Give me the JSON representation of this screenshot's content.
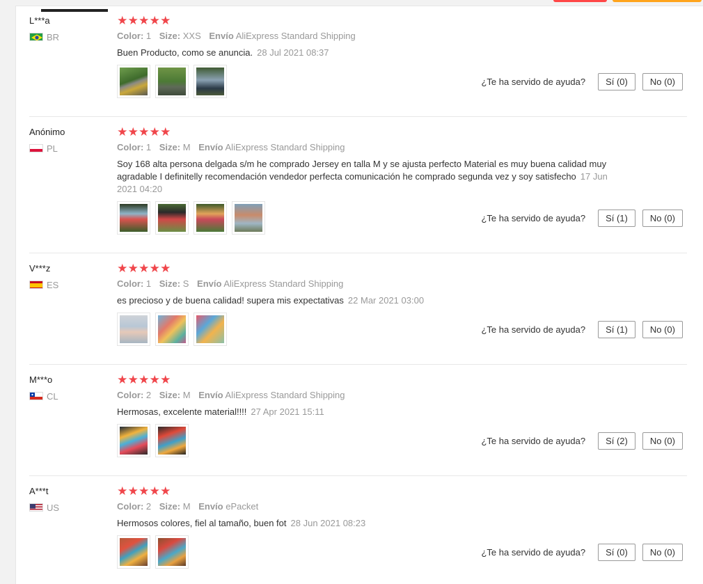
{
  "labels": {
    "color": "Color:",
    "size": "Size:",
    "shipping": "Envío",
    "helpful_question": "¿Te ha servido de ayuda?"
  },
  "colors": {
    "star": "#f0464b",
    "accent_red": "#ff4747",
    "accent_orange": "#ffa41c"
  },
  "reviews": [
    {
      "user": "L***a",
      "country": "BR",
      "flag": "brazil-flag-icon",
      "rating": 5,
      "color": "1",
      "size": "XXS",
      "shipping": "AliExpress Standard Shipping",
      "text": "Buen Producto, como se anuncia.",
      "date": "28 Jul 2021 08:37",
      "yes": "Sí (0)",
      "no": "No (0)"
    },
    {
      "user": "Anónimo",
      "country": "PL",
      "flag": "poland-flag-icon",
      "rating": 5,
      "color": "1",
      "size": "M",
      "shipping": "AliExpress Standard Shipping",
      "text": "Soy 168 alta persona delgada s/m he comprado Jersey en talla M y se ajusta perfecto Material es muy buena calidad muy agradable I definitelly recomendación vendedor perfecta comunicación he comprado segunda vez y soy satisfecho",
      "date": "17 Jun 2021 04:20",
      "yes": "Sí (1)",
      "no": "No (0)"
    },
    {
      "user": "V***z",
      "country": "ES",
      "flag": "spain-flag-icon",
      "rating": 5,
      "color": "1",
      "size": "S",
      "shipping": "AliExpress Standard Shipping",
      "text": "es precioso y de buena calidad! supera mis expectativas",
      "date": "22 Mar 2021 03:00",
      "yes": "Sí (1)",
      "no": "No (0)"
    },
    {
      "user": "M***o",
      "country": "CL",
      "flag": "chile-flag-icon",
      "rating": 5,
      "color": "2",
      "size": "M",
      "shipping": "AliExpress Standard Shipping",
      "text": "Hermosas, excelente material!!!!",
      "date": "27 Apr 2021 15:11",
      "yes": "Sí (2)",
      "no": "No (0)"
    },
    {
      "user": "A***t",
      "country": "US",
      "flag": "usa-flag-icon",
      "rating": 5,
      "color": "2",
      "size": "M",
      "shipping": "ePacket",
      "text": "Hermosos colores, fiel al tamaño, buen fot",
      "date": "28 Jun 2021 08:23",
      "yes": "Sí (0)",
      "no": "No (0)"
    }
  ]
}
